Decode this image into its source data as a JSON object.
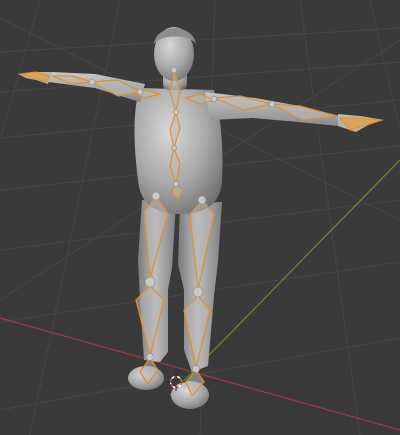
{
  "viewport": {
    "view": "3D Viewport",
    "background_color": "#3a3a3a",
    "grid_color": "#4a4a4a",
    "x_axis_color": "#9c3a4a",
    "y_axis_color": "#6a8a2a"
  },
  "model": {
    "name": "human-body-mesh",
    "color": "#a8a8a8"
  },
  "armature": {
    "name": "armature",
    "bone_color": "#e0902a",
    "bone_fill": "#b9b9b9"
  },
  "cursor": {
    "name": "3d-cursor",
    "icon": "3d-cursor-icon"
  }
}
